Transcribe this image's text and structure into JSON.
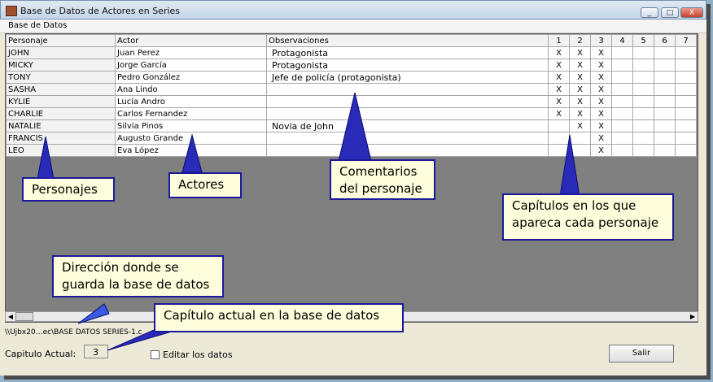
{
  "window": {
    "title": "Base de Datos de Actores en Series",
    "buttons": {
      "minimize": "_",
      "maximize": "□",
      "close": "X"
    }
  },
  "menu": {
    "item": "Base de Datos"
  },
  "grid": {
    "headers": {
      "personaje": "Personaje",
      "actor": "Actor",
      "observaciones": "Observaciones"
    },
    "chapters": [
      "1",
      "2",
      "3",
      "4",
      "5",
      "6",
      "7"
    ],
    "rows": [
      {
        "personaje": "JOHN",
        "actor": "Juan Perez",
        "obs": "Protagonista",
        "marks": [
          "X",
          "X",
          "X",
          "",
          "",
          "",
          ""
        ]
      },
      {
        "personaje": "MICKY",
        "actor": "Jorge García",
        "obs": "Protagonista",
        "marks": [
          "X",
          "X",
          "X",
          "",
          "",
          "",
          ""
        ]
      },
      {
        "personaje": "TONY",
        "actor": "Pedro González",
        "obs": "Jefe de policía (protagonista)",
        "marks": [
          "X",
          "X",
          "X",
          "",
          "",
          "",
          ""
        ]
      },
      {
        "personaje": "SASHA",
        "actor": "Ana Lindo",
        "obs": "",
        "marks": [
          "X",
          "X",
          "X",
          "",
          "",
          "",
          ""
        ]
      },
      {
        "personaje": "KYLIE",
        "actor": "Lucía Andro",
        "obs": "",
        "marks": [
          "X",
          "X",
          "X",
          "",
          "",
          "",
          ""
        ]
      },
      {
        "personaje": "CHARLIE",
        "actor": "Carlos Fernandez",
        "obs": "",
        "marks": [
          "X",
          "X",
          "X",
          "",
          "",
          "",
          ""
        ]
      },
      {
        "personaje": "NATALIE",
        "actor": "Silvia Pinos",
        "obs": "Novia de John",
        "marks": [
          "",
          "X",
          "X",
          "",
          "",
          "",
          ""
        ]
      },
      {
        "personaje": "FRANCIS",
        "actor": "Augusto Grande",
        "obs": "",
        "marks": [
          "",
          "",
          "X",
          "",
          "",
          "",
          ""
        ]
      },
      {
        "personaje": "LEO",
        "actor": "Eva López",
        "obs": "",
        "marks": [
          "",
          "",
          "X",
          "",
          "",
          "",
          ""
        ]
      }
    ]
  },
  "scrollbar": {
    "left": "◀",
    "right": "▶"
  },
  "footer": {
    "path": "\\\\Ujbx20…ec\\BASE DATOS SERIES-1.c",
    "capitulo_label": "Capitulo Actual:",
    "capitulo_value": "3",
    "editar_label": "Editar los datos",
    "salir": "Salir"
  },
  "callouts": {
    "personajes": "Personajes",
    "actores": "Actores",
    "comentarios": "Comentarios del personaje",
    "capitulos": "Capítulos en los que apareca cada personaje",
    "direccion": "Dirección donde se guarda la base de datos",
    "capitulo_actual": "Capítulo actual en la base de datos"
  }
}
